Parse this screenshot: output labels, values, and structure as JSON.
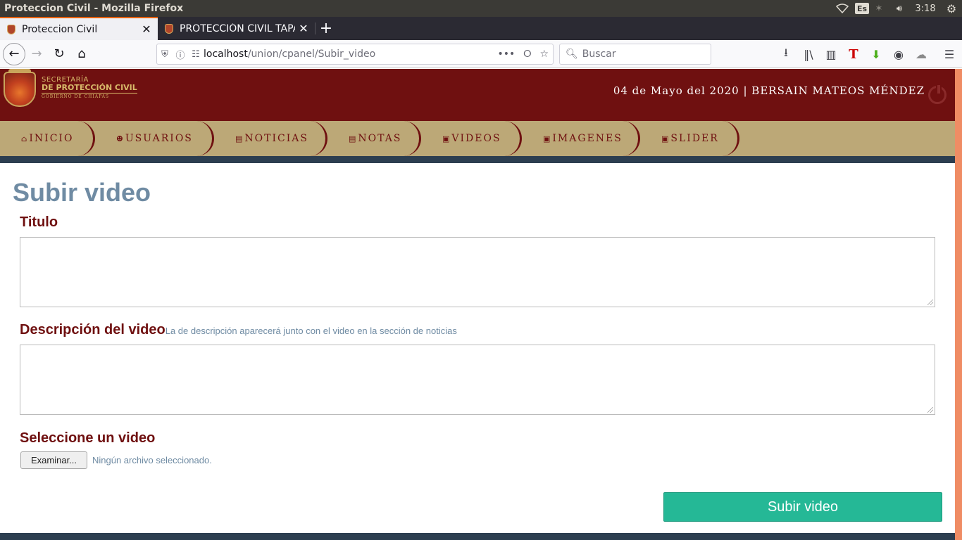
{
  "os": {
    "window_title": "Proteccion Civil - Mozilla Firefox",
    "keyboard_layout": "Es",
    "clock": "3:18"
  },
  "browser": {
    "tabs": [
      {
        "label": "Proteccion Civil",
        "active": true
      },
      {
        "label": "PROTECCIÓN CIVIL TAPA",
        "active": false
      }
    ],
    "url_host": "localhost",
    "url_path": "/union/cpanel/Subir_video",
    "search_placeholder": "Buscar"
  },
  "site": {
    "logo": {
      "line1": "SECRETARÍA",
      "line2": "DE PROTECCIÓN CIVIL",
      "line3": "GOBIERNO DE CHIAPAS"
    },
    "user_line": "04 de Mayo del 2020 | BERSAIN MATEOS MÉNDEZ",
    "menu": [
      {
        "label": "INICIO",
        "icon": "home-icon"
      },
      {
        "label": "USUARIOS",
        "icon": "users-icon"
      },
      {
        "label": "NOTICIAS",
        "icon": "file-icon"
      },
      {
        "label": "NOTAS",
        "icon": "file-text-icon"
      },
      {
        "label": "VIDEOS",
        "icon": "video-file-icon"
      },
      {
        "label": "IMAGENES",
        "icon": "image-file-icon"
      },
      {
        "label": "SLIDER",
        "icon": "image-file-icon"
      }
    ]
  },
  "form": {
    "page_title": "Subir video",
    "titulo_label": "Titulo",
    "titulo_value": "",
    "descripcion_label": "Descripción del video",
    "descripcion_hint": "La de descripción aparecerá junto con el video en la sección de noticias",
    "descripcion_value": "",
    "video_label": "Seleccione un video",
    "file_button": "Examinar...",
    "file_status": "Ningún archivo seleccionado.",
    "submit_label": "Subir video"
  },
  "colors": {
    "header_bg": "#6f1010",
    "menu_bg": "#bca877",
    "band": "#2c3e50",
    "submit": "#25b896",
    "title_color": "#6f8ba3"
  }
}
